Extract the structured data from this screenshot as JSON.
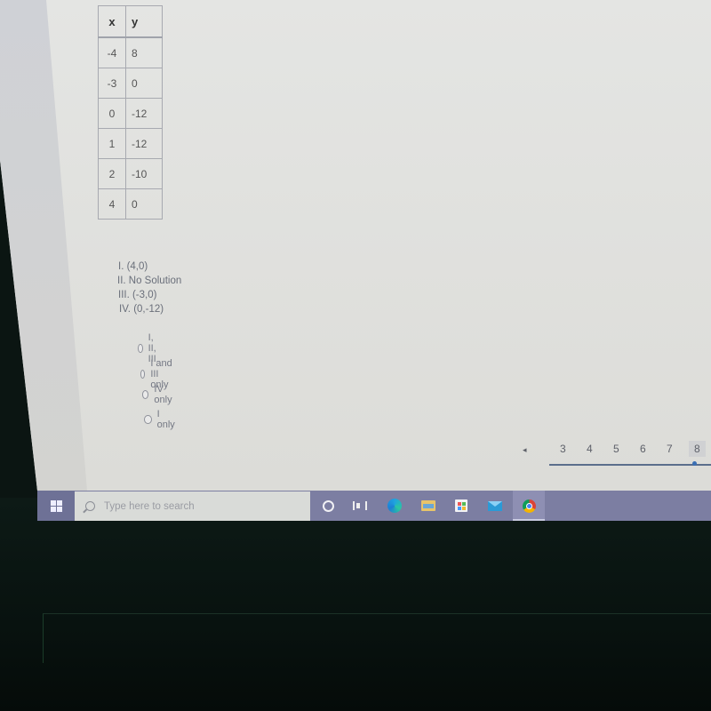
{
  "table": {
    "headers": [
      "x",
      "y"
    ],
    "rows": [
      [
        "-4",
        "8"
      ],
      [
        "-3",
        "0"
      ],
      [
        "0",
        "-12"
      ],
      [
        "1",
        "-12"
      ],
      [
        "2",
        "-10"
      ],
      [
        "4",
        "0"
      ]
    ]
  },
  "statements": [
    "I. (4,0)",
    "II. No Solution",
    "III. (-3,0)",
    "IV. (0,-12)"
  ],
  "options": [
    {
      "label": "I, II, III",
      "selected": false
    },
    {
      "label": "I and III only",
      "selected": false
    },
    {
      "label": "IV only",
      "selected": false
    },
    {
      "label": "I only",
      "selected": false
    }
  ],
  "pagination": {
    "prev_icon": "◂",
    "pages": [
      "3",
      "4",
      "5",
      "6",
      "7",
      "8"
    ],
    "current": "8"
  },
  "taskbar": {
    "search_placeholder": "Type here to search",
    "icons": [
      "windows-start-icon",
      "cortana-icon",
      "task-view-icon",
      "edge-icon",
      "file-explorer-icon",
      "store-icon",
      "mail-icon",
      "chrome-icon"
    ]
  }
}
